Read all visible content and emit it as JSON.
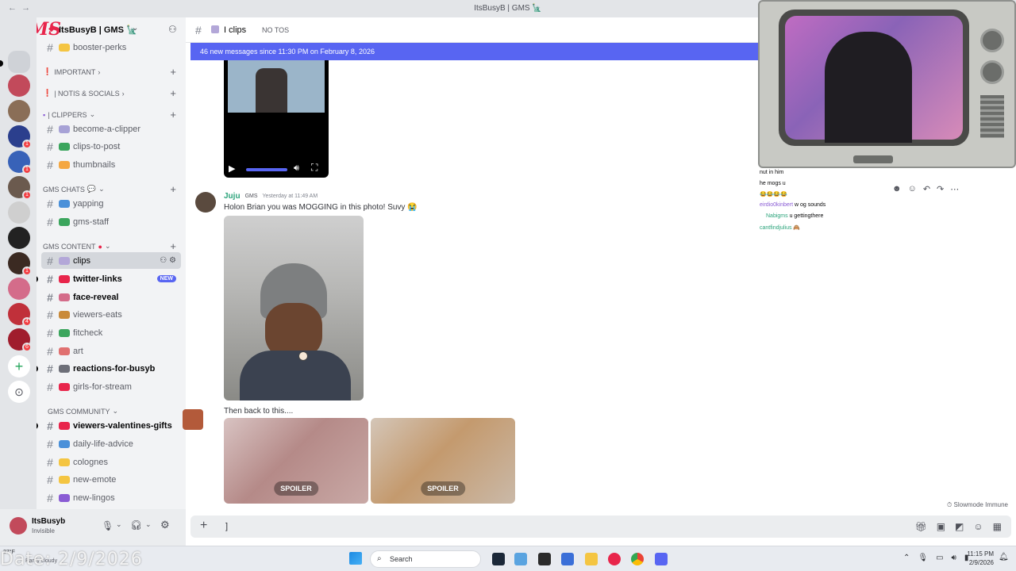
{
  "window": {
    "title": "ItsBusyB | GMS 🗽"
  },
  "server": {
    "name": "ItsBusyB | GMS 🗽",
    "logo_text": "GMS"
  },
  "sidebar": {
    "items": [
      {
        "type": "channel",
        "label": "booster-perks",
        "prefix": "✨",
        "state": "normal"
      },
      {
        "type": "category",
        "label": "IMPORTANT"
      },
      {
        "type": "category",
        "label": "| NOTIS & SOCIALS"
      },
      {
        "type": "category",
        "label": "| CLIPPERS"
      },
      {
        "type": "channel",
        "label": "become-a-clipper",
        "state": "normal"
      },
      {
        "type": "channel",
        "label": "clips-to-post",
        "state": "normal"
      },
      {
        "type": "channel",
        "label": "thumbnails",
        "state": "normal"
      },
      {
        "type": "category",
        "label": "GMS CHATS"
      },
      {
        "type": "channel",
        "label": "yapping",
        "state": "normal"
      },
      {
        "type": "channel",
        "label": "gms-staff",
        "state": "normal"
      },
      {
        "type": "category",
        "label": "GMS CONTENT"
      },
      {
        "type": "channel",
        "label": "clips",
        "state": "selected"
      },
      {
        "type": "channel",
        "label": "twitter-links",
        "state": "unread",
        "badge": "NEW"
      },
      {
        "type": "channel",
        "label": "face-reveal",
        "state": "unread"
      },
      {
        "type": "channel",
        "label": "viewers-eats",
        "state": "normal"
      },
      {
        "type": "channel",
        "label": "fitcheck",
        "state": "normal"
      },
      {
        "type": "channel",
        "label": "art",
        "state": "normal"
      },
      {
        "type": "channel",
        "label": "reactions-for-busyb",
        "state": "unread"
      },
      {
        "type": "channel",
        "label": "girls-for-stream",
        "state": "normal"
      },
      {
        "type": "category",
        "label": "GMS COMMUNITY"
      },
      {
        "type": "channel",
        "label": "viewers-valentines-gifts",
        "state": "unread"
      },
      {
        "type": "channel",
        "label": "daily-life-advice",
        "state": "normal"
      },
      {
        "type": "channel",
        "label": "colognes",
        "state": "normal"
      },
      {
        "type": "channel",
        "label": "new-emote",
        "state": "normal"
      },
      {
        "type": "channel",
        "label": "new-lingos",
        "state": "normal"
      }
    ]
  },
  "user_panel": {
    "name": "ItsBusyb",
    "status": "Invisible"
  },
  "channel_header": {
    "name": "clips",
    "topic": "NO TOS"
  },
  "new_banner": {
    "text": "46 new messages since 11:30 PM on February 8, 2026"
  },
  "messages": [
    {
      "author": "Juju",
      "tag": "GMS",
      "timestamp": "Yesterday at 11:49 AM",
      "text": "Holon Brian you was MOGGING in this photo! Suvy 😭"
    },
    {
      "author": "",
      "text": "Then back to this...."
    }
  ],
  "spoiler_label": "SPOILER",
  "composer": {
    "value": "]"
  },
  "slowmode": "Slowmode Immune",
  "overlay_chat": [
    {
      "user": "",
      "text": "nut in him",
      "color": "#d91c5c"
    },
    {
      "user": "",
      "text": "he mogs u",
      "color": "#d91c5c"
    },
    {
      "user": "",
      "text": "😂😂😂😂",
      "color": "#d91c5c"
    },
    {
      "user": "eirdio0kinbert",
      "text": "w og sounds",
      "color": "#8a5cd4"
    },
    {
      "user": "Nabigms",
      "text": "u gettingthere",
      "color": "#2aa37a"
    },
    {
      "user": "cantfindjulius",
      "text": "🙈",
      "color": "#2aa37a"
    }
  ],
  "taskbar": {
    "search": "Search",
    "weather_temp": "27°F",
    "weather_desc": "Partly cloudy",
    "time": "11:15 PM",
    "date": "2/9/2026",
    "date_watermark": "Date: 2/9/2026"
  },
  "colors": {
    "accent": "#5865f2",
    "sidebar_bg": "#f2f3f5",
    "main_bg": "#ffffff"
  }
}
